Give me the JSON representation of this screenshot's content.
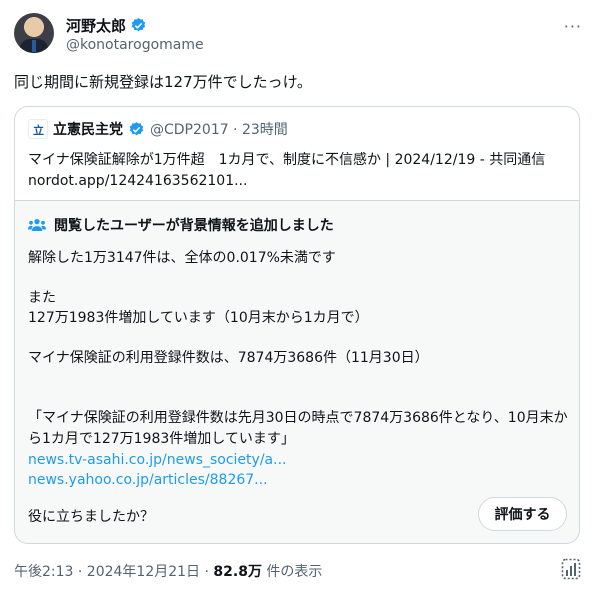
{
  "author": {
    "display_name": "河野太郎",
    "handle": "@konotarogomame"
  },
  "tweet": {
    "text": "同じ期間に新規登録は127万件でしたっけ。"
  },
  "quote": {
    "name": "立憲民主党",
    "meta": "@CDP2017 · 23時間",
    "line1": "マイナ保険証解除が1万件超　1カ月で、制度に不信感か | 2024/12/19 - 共同通信",
    "line2": "nordot.app/12424163562101..."
  },
  "note": {
    "title": "閲覧したユーザーが背景情報を追加しました",
    "p1": "解除した1万3147件は、全体の0.017%未満です",
    "p2a": "また",
    "p2b": "127万1983件増加しています（10月末から1カ月で）",
    "p3": "マイナ保険証の利用登録件数は、7874万3686件（11月30日）",
    "p4": "「マイナ保険証の利用登録件数は先月30日の時点で7874万3686件となり、10月末から1カ月で127万1983件増加しています」",
    "link1": "news.tv-asahi.co.jp/news_society/a...",
    "link2": "news.yahoo.co.jp/articles/88267...",
    "helpful_question": "役に立ちましたか？",
    "rate_button": "評価する"
  },
  "footer": {
    "timestamp": "午後2:13 · 2024年12月21日 · ",
    "views": "82.8万",
    "views_label": " 件の表示"
  },
  "colors": {
    "verified": "#1d9bf0",
    "link": "#1d9bf0",
    "note_icon": "#1d9bf0"
  }
}
